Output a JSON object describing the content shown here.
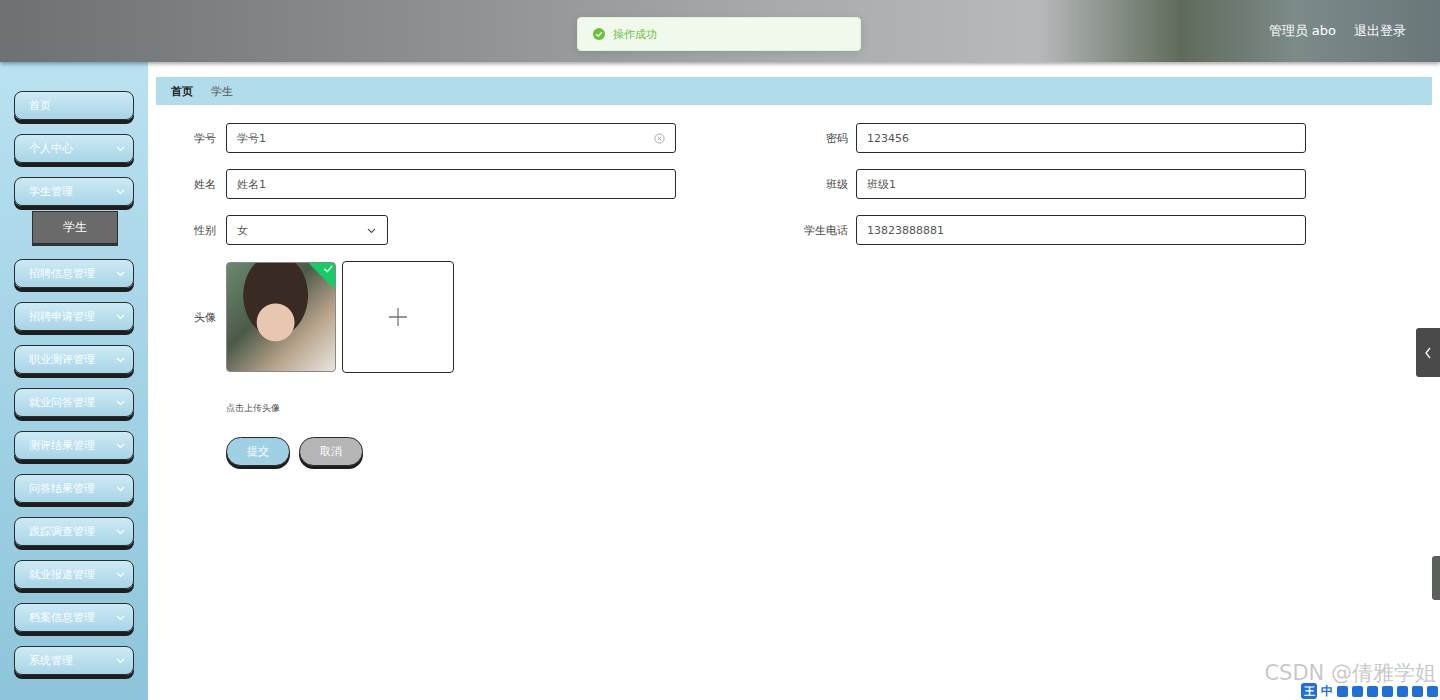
{
  "header": {
    "user": "管理员 abo",
    "logout": "退出登录"
  },
  "toast": {
    "text": "操作成功"
  },
  "sidebar": {
    "items": [
      {
        "label": "首页",
        "kind": "menu",
        "expandable": false,
        "selected": false
      },
      {
        "label": "个人中心",
        "kind": "menu",
        "expandable": true,
        "selected": false
      },
      {
        "label": "学生管理",
        "kind": "menu",
        "expandable": true,
        "selected": false
      },
      {
        "label": "学生",
        "kind": "sub",
        "expandable": false,
        "selected": true
      },
      {
        "label": "招聘信息管理",
        "kind": "menu",
        "expandable": true,
        "selected": false
      },
      {
        "label": "招聘申请管理",
        "kind": "menu",
        "expandable": true,
        "selected": false
      },
      {
        "label": "职业测评管理",
        "kind": "menu",
        "expandable": true,
        "selected": false
      },
      {
        "label": "就业问答管理",
        "kind": "menu",
        "expandable": true,
        "selected": false
      },
      {
        "label": "测评结果管理",
        "kind": "menu",
        "expandable": true,
        "selected": false
      },
      {
        "label": "问答结果管理",
        "kind": "menu",
        "expandable": true,
        "selected": false
      },
      {
        "label": "跟踪调查管理",
        "kind": "menu",
        "expandable": true,
        "selected": false
      },
      {
        "label": "就业报道管理",
        "kind": "menu",
        "expandable": true,
        "selected": false
      },
      {
        "label": "档案信息管理",
        "kind": "menu",
        "expandable": true,
        "selected": false
      },
      {
        "label": "系统管理",
        "kind": "menu",
        "expandable": true,
        "selected": false
      }
    ]
  },
  "breadcrumb": [
    "首页",
    "学生"
  ],
  "form": {
    "fields": [
      {
        "label": "学号",
        "value": "学号1",
        "kind": "text",
        "clearable": true
      },
      {
        "label": "密码",
        "value": "123456",
        "kind": "text",
        "clearable": false
      },
      {
        "label": "姓名",
        "value": "姓名1",
        "kind": "text",
        "clearable": false
      },
      {
        "label": "班级",
        "value": "班级1",
        "kind": "text",
        "clearable": false
      },
      {
        "label": "性别",
        "value": "女",
        "kind": "select",
        "clearable": false
      },
      {
        "label": "学生电话",
        "value": "13823888881",
        "kind": "text",
        "clearable": false
      }
    ],
    "avatar": {
      "label": "头像",
      "hint": "点击上传头像",
      "uploaded": true
    },
    "buttons": [
      {
        "label": "提交",
        "kind": "primary"
      },
      {
        "label": "取消",
        "kind": "secondary"
      }
    ]
  },
  "watermark": "CSDN @倩雅学姐",
  "ime": [
    "王",
    "中"
  ]
}
